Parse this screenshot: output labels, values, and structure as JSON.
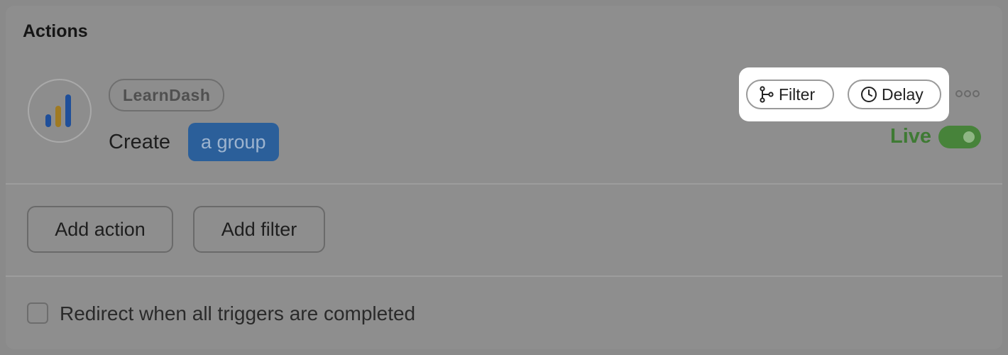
{
  "section": {
    "title": "Actions"
  },
  "action": {
    "app_logo_icon": "learndash-bars-icon",
    "app_name": "LearnDash",
    "verb": "Create",
    "object": "a group",
    "filter_label": "Filter",
    "delay_label": "Delay",
    "more_icon": "more-dots-icon",
    "status_label": "Live",
    "status_on": true,
    "colors": {
      "chip_bg": "#2b5f9a",
      "live_green": "#3f7a34",
      "logo_blue": "#1f4f9a",
      "logo_gold": "#a07a22"
    }
  },
  "buttons": {
    "add_action": "Add action",
    "add_filter": "Add filter"
  },
  "redirect": {
    "label": "Redirect when all triggers are completed",
    "checked": false
  }
}
